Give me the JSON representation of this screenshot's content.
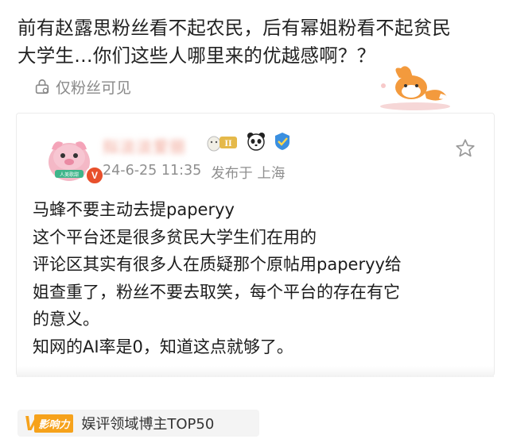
{
  "post": {
    "title": "前有赵露思粉丝看不起农民，后有幂姐粉看不起贫民大学生…你们这些人哪里来的优越感啊？？",
    "visibility_label": "仅粉丝可见"
  },
  "comment": {
    "username": "拟淡淡爱丽",
    "level_badge": "II",
    "time": "24-6-25 11:35",
    "location": "发布于 上海",
    "lines": [
      "马蜂不要主动去提paperyy",
      "这个平台还是很多贫民大学生们在用的",
      "评论区其实有很多人在质疑那个原帖用paperyy给",
      "姐查重了，粉丝不要去取笑，每个平台的存在有它",
      "的意义。",
      "知网的AI率是0，知道这点就够了。"
    ],
    "verified_badge": "V",
    "avatar_caption": "人美歌甜"
  },
  "honor": {
    "logo_letter": "V",
    "logo_tag": "影响力",
    "text": "娱评领域博主TOP50"
  },
  "colors": {
    "accent": "#f6a21b",
    "verified": "#e8502c",
    "meta": "#8f8f8f"
  },
  "icons": [
    "lock-icon",
    "fox-sticker",
    "star-icon",
    "panda-icon",
    "badge-icon",
    "level-icon"
  ]
}
